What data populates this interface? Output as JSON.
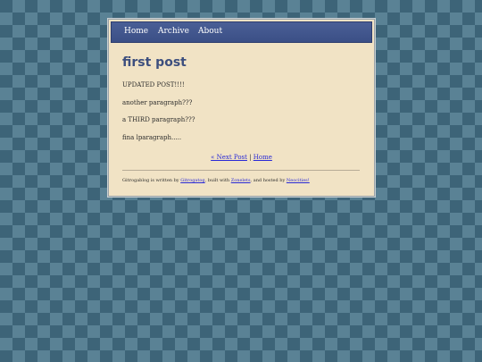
{
  "nav": {
    "home": "Home",
    "archive": "Archive",
    "about": "About"
  },
  "post": {
    "title": "first post",
    "paragraphs": [
      "UPDATED POST!!!!",
      "another paragraph???",
      "a THIRD paragraph???",
      "fina lparagraph....."
    ]
  },
  "post_nav": {
    "next": "« Next Post",
    "separator": "|",
    "home": "Home"
  },
  "footer": {
    "prefix": "Gitrogablog is written by ",
    "author": "Gitrogatog",
    "mid1": ", built with ",
    "builder": "Zonelets",
    "mid2": ", and hosted by ",
    "host": "Neocities!"
  },
  "colors": {
    "background": "#3d6478",
    "page": "#f1e3c5",
    "navbar": "#3b4f86",
    "title": "#3d4f7e",
    "link": "#2a2ad6"
  }
}
